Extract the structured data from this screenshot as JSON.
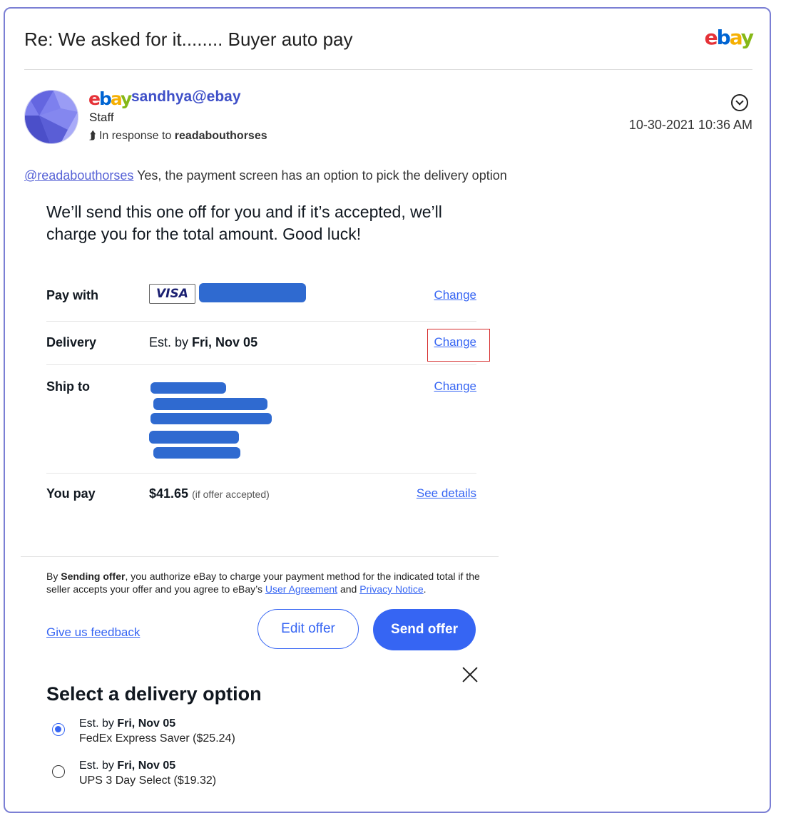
{
  "post": {
    "title": "Re: We asked for it........ Buyer auto pay",
    "username": "sandhya@ebay",
    "role": "Staff",
    "in_response_prefix": "In response to",
    "in_response_user": "readabouthorses",
    "timestamp": "10-30-2021 10:36 AM",
    "mention": "@readabouthorses",
    "message": "Yes, the payment screen has an option to pick the delivery option"
  },
  "logo": {
    "e": "e",
    "b": "b",
    "a": "a",
    "y": "y"
  },
  "offer": {
    "headline": "We’ll send this one off for you and if it’s accepted, we’ll charge you for the total amount. Good luck!",
    "pay_with_label": "Pay with",
    "visa_label": "VISA",
    "change_label": "Change",
    "delivery_label": "Delivery",
    "delivery_prefix": "Est. by",
    "delivery_date": "Fri, Nov 05",
    "ship_to_label": "Ship to",
    "you_pay_label": "You pay",
    "you_pay_amount": "$41.65",
    "you_pay_note": "(if offer accepted)",
    "see_details_label": "See details",
    "disclaimer_1": "By ",
    "disclaimer_bold": "Sending offer",
    "disclaimer_2": ", you authorize eBay to charge your payment method for the indicated total if the seller accepts your offer and you agree to eBay’s ",
    "user_agreement": "User Agreement",
    "disclaimer_and": " and ",
    "privacy_notice": "Privacy Notice",
    "disclaimer_end": ".",
    "feedback_label": "Give us feedback",
    "edit_offer_label": "Edit offer",
    "send_offer_label": "Send offer"
  },
  "delivery_sheet": {
    "heading": "Select a delivery option",
    "options": [
      {
        "prefix": "Est. by",
        "date": "Fri, Nov 05",
        "service": "FedEx Express Saver ($25.24)",
        "selected": true
      },
      {
        "prefix": "Est. by",
        "date": "Fri, Nov 05",
        "service": "UPS 3 Day Select ($19.32)",
        "selected": false
      }
    ]
  },
  "colors": {
    "accent": "#3665f3",
    "username": "#3f50c8",
    "highlight_box": "#d62b2b",
    "redaction": "#2f6ad0"
  }
}
